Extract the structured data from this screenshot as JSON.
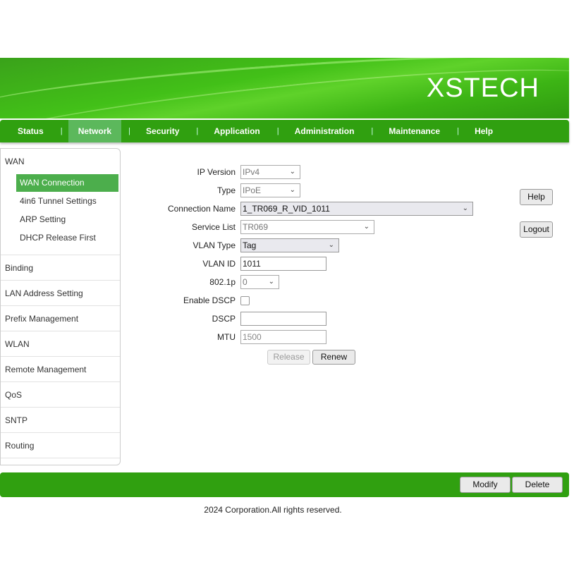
{
  "header": {
    "logo": "XSTECH"
  },
  "nav": [
    "Status",
    "Network",
    "Security",
    "Application",
    "Administration",
    "Maintenance",
    "Help"
  ],
  "sidebar": {
    "groups": [
      {
        "label": "WAN",
        "items": [
          "WAN Connection",
          "4in6 Tunnel Settings",
          "ARP Setting",
          "DHCP Release First"
        ]
      },
      {
        "label": "Binding"
      },
      {
        "label": "LAN Address Setting"
      },
      {
        "label": "Prefix Management"
      },
      {
        "label": "WLAN"
      },
      {
        "label": "Remote Management"
      },
      {
        "label": "QoS"
      },
      {
        "label": "SNTP"
      },
      {
        "label": "Routing"
      }
    ]
  },
  "form": {
    "ip_version": {
      "label": "IP Version",
      "value": "IPv4"
    },
    "type": {
      "label": "Type",
      "value": "IPoE"
    },
    "connection_name": {
      "label": "Connection Name",
      "value": "1_TR069_R_VID_1011"
    },
    "service_list": {
      "label": "Service List",
      "value": "TR069"
    },
    "vlan_type": {
      "label": "VLAN Type",
      "value": "Tag"
    },
    "vlan_id": {
      "label": "VLAN ID",
      "value": "1011"
    },
    "p8021": {
      "label": "802.1p",
      "value": "0"
    },
    "enable_dscp": {
      "label": "Enable DSCP",
      "checked": false
    },
    "dscp": {
      "label": "DSCP",
      "value": ""
    },
    "mtu": {
      "label": "MTU",
      "value": "1500"
    },
    "release": "Release",
    "renew": "Renew"
  },
  "side_buttons": {
    "help": "Help",
    "logout": "Logout"
  },
  "bottom": {
    "modify": "Modify",
    "delete": "Delete"
  },
  "footer": "2024 Corporation.All rights reserved."
}
